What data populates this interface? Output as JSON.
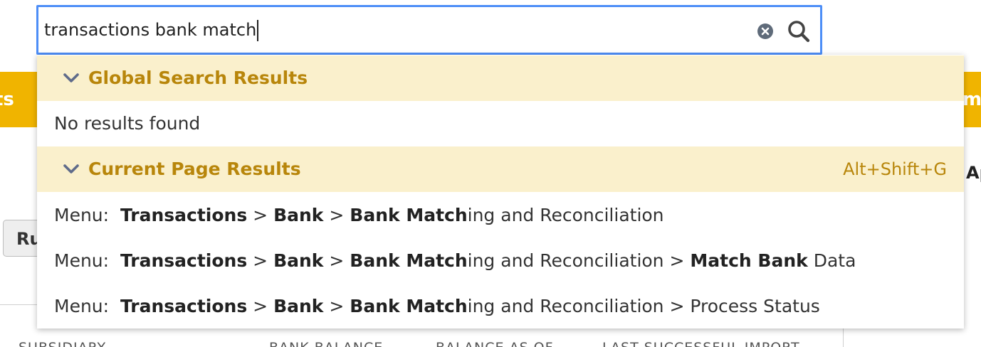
{
  "background": {
    "left_bar_text": "ts",
    "right_bar_text": "m",
    "right_text": "Ap",
    "run_button_label": "Ru",
    "columns": [
      "SUBSIDIARY",
      "BANK BALANCE",
      "BALANCE AS OF",
      "LAST SUCCESSFUL IMPORT"
    ]
  },
  "search": {
    "value": "transactions bank match",
    "clear_icon": "clear-circle-icon",
    "search_icon": "magnifier-icon"
  },
  "dropdown": {
    "global_header": "Global Search Results",
    "global_empty": "No results found",
    "current_header": "Current Page Results",
    "current_shortcut": "Alt+Shift+G",
    "results": [
      {
        "prefix": "Menu:",
        "parts": [
          {
            "bold": true,
            "text": "Transactions"
          },
          {
            "bold": false,
            "text": " > "
          },
          {
            "bold": true,
            "text": "Bank"
          },
          {
            "bold": false,
            "text": " > "
          },
          {
            "bold": true,
            "text": "Bank Match"
          },
          {
            "bold": false,
            "text": "ing and Reconciliation"
          }
        ]
      },
      {
        "prefix": "Menu:",
        "parts": [
          {
            "bold": true,
            "text": "Transactions"
          },
          {
            "bold": false,
            "text": " > "
          },
          {
            "bold": true,
            "text": "Bank"
          },
          {
            "bold": false,
            "text": " > "
          },
          {
            "bold": true,
            "text": "Bank Match"
          },
          {
            "bold": false,
            "text": "ing and Reconciliation > "
          },
          {
            "bold": true,
            "text": "Match Bank"
          },
          {
            "bold": false,
            "text": " Data"
          }
        ]
      },
      {
        "prefix": "Menu:",
        "parts": [
          {
            "bold": true,
            "text": "Transactions"
          },
          {
            "bold": false,
            "text": " > "
          },
          {
            "bold": true,
            "text": "Bank"
          },
          {
            "bold": false,
            "text": " > "
          },
          {
            "bold": true,
            "text": "Bank Match"
          },
          {
            "bold": false,
            "text": "ing and Reconciliation > Process Status"
          }
        ]
      }
    ]
  },
  "colors": {
    "accent_bar": "#f0b400",
    "header_bg": "#faf0cc",
    "header_text": "#b8860b",
    "focus_border": "#4d8ef7",
    "icon_gray": "#5f6b7a"
  }
}
